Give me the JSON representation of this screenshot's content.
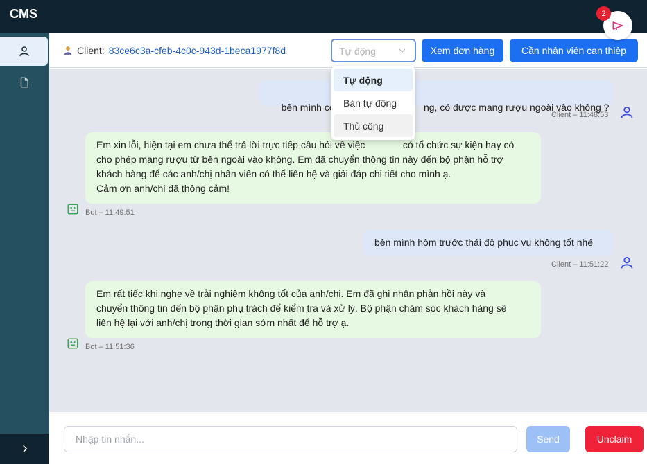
{
  "app": {
    "title": "CMS"
  },
  "notifications": {
    "count": "2",
    "icon": "megaphone-icon"
  },
  "sidebar": {
    "items": [
      {
        "name": "user-icon",
        "active": true
      },
      {
        "name": "document-icon",
        "active": false
      }
    ],
    "expand_icon": "chevron-right-icon"
  },
  "header": {
    "client_label": "Client:",
    "client_id": "83ce6c3a-cfeb-4c0c-943d-1beca1977f8d",
    "mode_placeholder": "Tự động",
    "view_orders_label": "Xem đơn hàng",
    "request_staff_label": "Cần nhân viên can thiệp"
  },
  "mode_dropdown": {
    "options": [
      "Tự động",
      "Bán tự động",
      "Thủ công"
    ],
    "selected": "Tự động"
  },
  "messages": [
    {
      "sender": "client",
      "text": "bên mình có t                               ng, có được mang rượu ngoài vào không ?",
      "meta": "Client – 11:48:53"
    },
    {
      "sender": "bot",
      "lines": [
        "Em xin lỗi, hiện tại em chưa thể trả lời trực tiếp câu hỏi về việc              có tổ chức sự kiện hay có",
        "cho phép mang rượu từ bên ngoài vào không. Em đã chuyển thông tin này đến bộ phận hỗ trợ",
        "khách hàng để các anh/chị nhân viên có thể liên hệ và giải đáp chi tiết cho mình ạ.",
        "Cảm ơn anh/chị đã thông cảm!"
      ],
      "meta": "Bot – 11:49:51"
    },
    {
      "sender": "client",
      "text": "bên mình hôm trước thái độ phục vụ không tốt nhé",
      "meta": "Client – 11:51:22"
    },
    {
      "sender": "bot",
      "lines": [
        "Em rất tiếc khi nghe về trải nghiệm không tốt của anh/chị. Em đã ghi nhận phản hồi này và",
        "chuyển thông tin đến bộ phận phụ trách để kiểm tra và xử lý. Bộ phận chăm sóc khách hàng sẽ",
        "liên hệ lại với anh/chị trong thời gian sớm nhất để hỗ trợ ạ."
      ],
      "meta": "Bot – 11:51:36"
    }
  ],
  "composer": {
    "placeholder": "Nhập tin nhắn...",
    "send_label": "Send",
    "unclaim_label": "Unclaim"
  },
  "colors": {
    "topbar": "#0f2331",
    "sidebar": "#24505f",
    "primary_button": "#1d6ff2",
    "client_bubble": "#dde7f7",
    "bot_bubble": "#e7f9e3",
    "danger_button": "#f0223a",
    "user_icon": "#3f4fd8",
    "bot_icon": "#3aa857"
  }
}
